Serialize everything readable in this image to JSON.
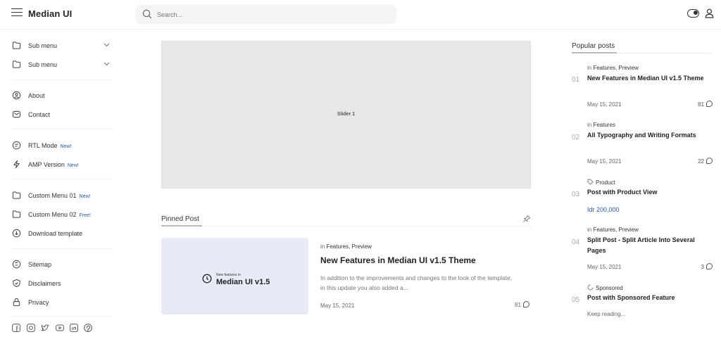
{
  "header": {
    "brand": "Median UI",
    "search_placeholder": "Search..."
  },
  "sidebar": {
    "items": [
      {
        "label": "Sub menu",
        "icon": "folder-icon",
        "has_chevron": true
      },
      {
        "label": "Sub menu",
        "icon": "folder-icon",
        "has_chevron": true
      },
      {
        "label": "About",
        "icon": "person-icon"
      },
      {
        "label": "Contact",
        "icon": "mail-icon"
      },
      {
        "label": "RTL Mode",
        "icon": "rtl-icon",
        "badge": "New!"
      },
      {
        "label": "AMP Version",
        "icon": "lightning-icon",
        "badge": "New!"
      },
      {
        "label": "Custom Menu 01",
        "icon": "folder-icon",
        "badge": "New!"
      },
      {
        "label": "Custom Menu 02",
        "icon": "folder-icon",
        "badge": "Free!"
      },
      {
        "label": "Download template",
        "icon": "download-icon"
      },
      {
        "label": "Sitemap",
        "icon": "sitemap-icon"
      },
      {
        "label": "Disclaimers",
        "icon": "shield-icon"
      },
      {
        "label": "Privacy",
        "icon": "lock-icon"
      }
    ],
    "socials": [
      "facebook-icon",
      "instagram-icon",
      "twitter-icon",
      "youtube-icon",
      "linkedin-icon",
      "pinterest-icon"
    ]
  },
  "main": {
    "slider_caption": "Slider 1",
    "pinned": {
      "section_title": "Pinned Post",
      "thumb_small": "New features in",
      "thumb_big": "Median UI v1.5",
      "category_prefix": "in",
      "category": "Features, Preview",
      "title": "New Features in Median UI v1.5 Theme",
      "snippet": "In addition to the improvements and changes to the look of the template, in this update you also added a...",
      "date": "May 15, 2021",
      "comments": "81"
    }
  },
  "popular": {
    "title": "Popular posts",
    "posts": [
      {
        "num": "01",
        "prefix": "in",
        "category": "Features, Preview",
        "title": "New Features in Median UI v1.5 Theme",
        "date": "May 15, 2021",
        "comments": "81"
      },
      {
        "num": "02",
        "prefix": "in",
        "category": "Features",
        "title": "All Typography and Writing Formats",
        "date": "May 15, 2021",
        "comments": "22"
      },
      {
        "num": "03",
        "category": "Product",
        "title": "Post with Product View",
        "price": "Idr 200,000"
      },
      {
        "num": "04",
        "prefix": "in",
        "category": "Features, Preview",
        "title": "Split Post - Split Article Into Several Pages",
        "date": "May 15, 2021",
        "comments": "3"
      },
      {
        "num": "05",
        "category": "Sponsored",
        "title": "Post with Sponsored Feature",
        "keep": "Keep reading..."
      }
    ]
  },
  "colors": {
    "accent": "#2a57b5",
    "slider_bg": "#e8e8e8",
    "thumb_bg": "#e8ebf6"
  }
}
